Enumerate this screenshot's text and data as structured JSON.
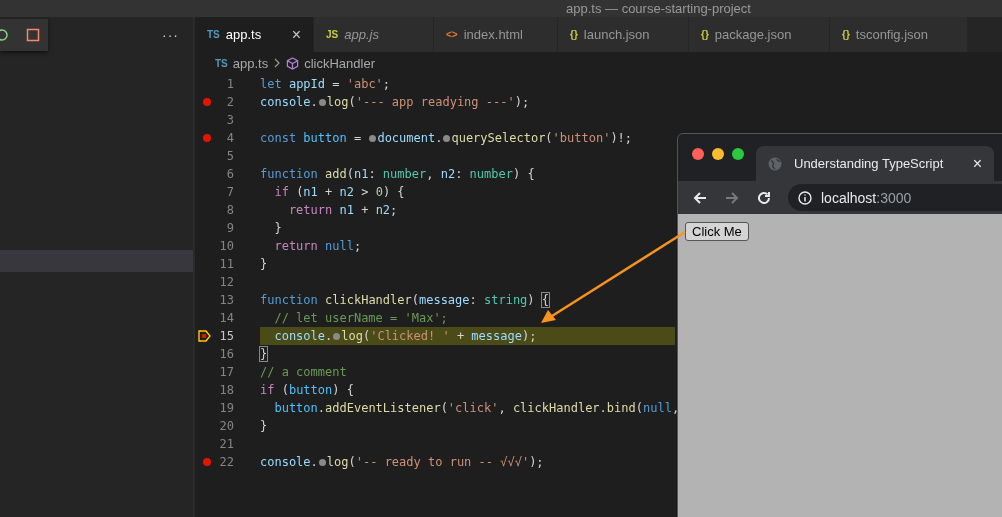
{
  "window": {
    "title": "app.ts — course-starting-project"
  },
  "debug_toolbar": {
    "more": "···"
  },
  "tabs": [
    {
      "badge": "TS",
      "kind": "ts",
      "label": "app.ts",
      "selected": true,
      "preview": false,
      "close": "×"
    },
    {
      "badge": "JS",
      "kind": "js",
      "label": "app.js",
      "selected": false,
      "preview": true
    },
    {
      "badge": "<>",
      "kind": "html",
      "label": "index.html",
      "selected": false,
      "preview": false
    },
    {
      "badge": "{}",
      "kind": "json",
      "label": "launch.json",
      "selected": false,
      "preview": false
    },
    {
      "badge": "{}",
      "kind": "json",
      "label": "package.json",
      "selected": false,
      "preview": false
    },
    {
      "badge": "{}",
      "kind": "json",
      "label": "tsconfig.json",
      "selected": false,
      "preview": false
    }
  ],
  "breadcrumb": {
    "badge": "TS",
    "file": "app.ts",
    "symbol": "clickHandler"
  },
  "lines": [
    {
      "n": "1",
      "breakpoint": false,
      "current": false,
      "tokens": [
        {
          "kind": "kw",
          "t": "let "
        },
        {
          "kind": "var",
          "t": "appId"
        },
        {
          "kind": "plain",
          "t": " = "
        },
        {
          "kind": "str",
          "t": "'abc'"
        },
        {
          "kind": "plain",
          "t": ";"
        }
      ]
    },
    {
      "n": "2",
      "breakpoint": true,
      "current": false,
      "tokens": [
        {
          "kind": "var",
          "t": "console"
        },
        {
          "kind": "plain",
          "t": "."
        },
        {
          "kind": "hint"
        },
        {
          "kind": "func",
          "t": "log"
        },
        {
          "kind": "plain",
          "t": "("
        },
        {
          "kind": "str",
          "t": "'--- app readying ---'"
        },
        {
          "kind": "plain",
          "t": ");"
        }
      ]
    },
    {
      "n": "3",
      "breakpoint": false,
      "current": false
    },
    {
      "n": "4",
      "breakpoint": true,
      "current": false,
      "tokens": [
        {
          "kind": "kw",
          "t": "const "
        },
        {
          "kind": "const",
          "t": "button"
        },
        {
          "kind": "plain",
          "t": " = "
        },
        {
          "kind": "hint"
        },
        {
          "kind": "var",
          "t": "document"
        },
        {
          "kind": "plain",
          "t": "."
        },
        {
          "kind": "hint"
        },
        {
          "kind": "func",
          "t": "querySelector"
        },
        {
          "kind": "plain",
          "t": "("
        },
        {
          "kind": "str",
          "t": "'button'"
        },
        {
          "kind": "plain",
          "t": ")!;"
        }
      ]
    },
    {
      "n": "5",
      "breakpoint": false,
      "current": false
    },
    {
      "n": "6",
      "breakpoint": false,
      "current": false,
      "tokens": [
        {
          "kind": "kw",
          "t": "function "
        },
        {
          "kind": "func",
          "t": "add"
        },
        {
          "kind": "plain",
          "t": "("
        },
        {
          "kind": "var",
          "t": "n1"
        },
        {
          "kind": "plain",
          "t": ": "
        },
        {
          "kind": "type",
          "t": "number"
        },
        {
          "kind": "plain",
          "t": ", "
        },
        {
          "kind": "var",
          "t": "n2"
        },
        {
          "kind": "plain",
          "t": ": "
        },
        {
          "kind": "type",
          "t": "number"
        },
        {
          "kind": "plain",
          "t": ") {"
        }
      ]
    },
    {
      "n": "7",
      "breakpoint": false,
      "current": false,
      "tokens": [
        {
          "kind": "ctl",
          "t": "  if"
        },
        {
          "kind": "plain",
          "t": " ("
        },
        {
          "kind": "var",
          "t": "n1"
        },
        {
          "kind": "plain",
          "t": " + "
        },
        {
          "kind": "var",
          "t": "n2"
        },
        {
          "kind": "plain",
          "t": " > "
        },
        {
          "kind": "num",
          "t": "0"
        },
        {
          "kind": "plain",
          "t": ") {"
        }
      ]
    },
    {
      "n": "8",
      "breakpoint": false,
      "current": false,
      "tokens": [
        {
          "kind": "ctl",
          "t": "    return "
        },
        {
          "kind": "var",
          "t": "n1"
        },
        {
          "kind": "plain",
          "t": " + "
        },
        {
          "kind": "var",
          "t": "n2"
        },
        {
          "kind": "plain",
          "t": ";"
        }
      ]
    },
    {
      "n": "9",
      "breakpoint": false,
      "current": false,
      "tokens": [
        {
          "kind": "plain",
          "t": "  }"
        }
      ]
    },
    {
      "n": "10",
      "breakpoint": false,
      "current": false,
      "tokens": [
        {
          "kind": "ctl",
          "t": "  return "
        },
        {
          "kind": "kw",
          "t": "null"
        },
        {
          "kind": "plain",
          "t": ";"
        }
      ]
    },
    {
      "n": "11",
      "breakpoint": false,
      "current": false,
      "tokens": [
        {
          "kind": "plain",
          "t": "}"
        }
      ]
    },
    {
      "n": "12",
      "breakpoint": false,
      "current": false
    },
    {
      "n": "13",
      "breakpoint": false,
      "current": false,
      "tokens": [
        {
          "kind": "kw",
          "t": "function "
        },
        {
          "kind": "func",
          "t": "clickHandler"
        },
        {
          "kind": "plain",
          "t": "("
        },
        {
          "kind": "var",
          "t": "message"
        },
        {
          "kind": "plain",
          "t": ": "
        },
        {
          "kind": "type",
          "t": "string"
        },
        {
          "kind": "plain",
          "t": ") "
        },
        {
          "kind": "match",
          "t": "{"
        }
      ]
    },
    {
      "n": "14",
      "breakpoint": false,
      "current": false,
      "tokens": [
        {
          "kind": "comment",
          "t": "  // let userName = 'Max';"
        }
      ]
    },
    {
      "n": "15",
      "breakpoint": true,
      "current": true,
      "tokens": [
        {
          "kind": "var",
          "t": "  console"
        },
        {
          "kind": "plain",
          "t": "."
        },
        {
          "kind": "hint"
        },
        {
          "kind": "func",
          "t": "log"
        },
        {
          "kind": "plain",
          "t": "("
        },
        {
          "kind": "str",
          "t": "'Clicked! '"
        },
        {
          "kind": "plain",
          "t": " + "
        },
        {
          "kind": "var",
          "t": "message"
        },
        {
          "kind": "plain",
          "t": ");"
        }
      ]
    },
    {
      "n": "16",
      "breakpoint": false,
      "current": false,
      "tokens": [
        {
          "kind": "match",
          "t": "}"
        }
      ]
    },
    {
      "n": "17",
      "breakpoint": false,
      "current": false,
      "tokens": [
        {
          "kind": "comment",
          "t": "// a comment"
        }
      ]
    },
    {
      "n": "18",
      "breakpoint": false,
      "current": false,
      "tokens": [
        {
          "kind": "ctl",
          "t": "if"
        },
        {
          "kind": "plain",
          "t": " ("
        },
        {
          "kind": "const",
          "t": "button"
        },
        {
          "kind": "plain",
          "t": ") {"
        }
      ]
    },
    {
      "n": "19",
      "breakpoint": false,
      "current": false,
      "tokens": [
        {
          "kind": "const",
          "t": "  button"
        },
        {
          "kind": "plain",
          "t": "."
        },
        {
          "kind": "func",
          "t": "addEventListener"
        },
        {
          "kind": "plain",
          "t": "("
        },
        {
          "kind": "str",
          "t": "'click'"
        },
        {
          "kind": "plain",
          "t": ", "
        },
        {
          "kind": "func",
          "t": "clickHandler"
        },
        {
          "kind": "plain",
          "t": "."
        },
        {
          "kind": "func",
          "t": "bind"
        },
        {
          "kind": "plain",
          "t": "("
        },
        {
          "kind": "kw",
          "t": "null"
        },
        {
          "kind": "plain",
          "t": ","
        }
      ]
    },
    {
      "n": "20",
      "breakpoint": false,
      "current": false,
      "tokens": [
        {
          "kind": "plain",
          "t": "}"
        }
      ]
    },
    {
      "n": "21",
      "breakpoint": false,
      "current": false
    },
    {
      "n": "22",
      "breakpoint": true,
      "current": false,
      "tokens": [
        {
          "kind": "var",
          "t": "console"
        },
        {
          "kind": "plain",
          "t": "."
        },
        {
          "kind": "hint"
        },
        {
          "kind": "func",
          "t": "log"
        },
        {
          "kind": "plain",
          "t": "("
        },
        {
          "kind": "str",
          "t": "'-- ready to run -- √√√'"
        },
        {
          "kind": "plain",
          "t": ");"
        }
      ]
    }
  ],
  "browser": {
    "tab_title": "Understanding TypeScript",
    "tab_close": "×",
    "nav": [
      {
        "kind": "back",
        "disabled": false
      },
      {
        "kind": "forward",
        "disabled": true
      },
      {
        "kind": "reload",
        "disabled": false
      }
    ],
    "url_host": "localhost",
    "url_port": ":3000",
    "page_button": "Click Me"
  }
}
